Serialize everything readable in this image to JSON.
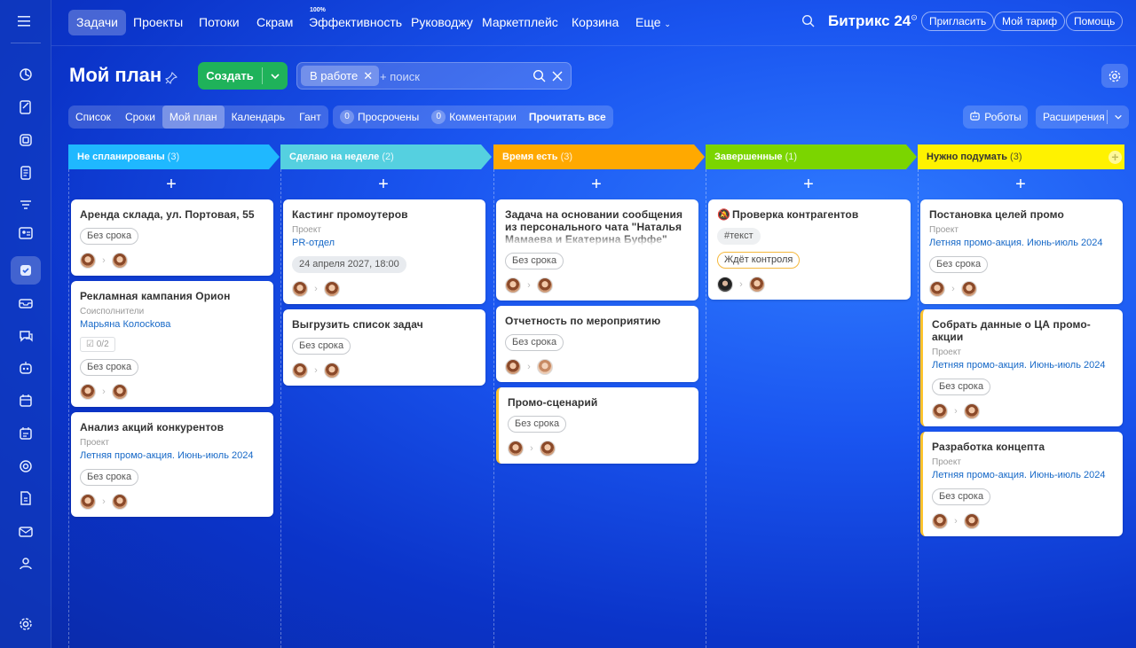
{
  "nav": {
    "items": [
      "Задачи",
      "Проекты",
      "Потоки",
      "Скрам",
      "Эффективность",
      "Руководжу",
      "Маркетплейс",
      "Корзина",
      "Еще"
    ],
    "efficiency_badge": "100%",
    "brand": "Битрикс",
    "brand_num": "24",
    "invite": "Пригласить",
    "tariff": "Мой тариф",
    "help": "Помощь"
  },
  "header": {
    "title": "Мой план",
    "create": "Создать",
    "filter_chip": "В работе",
    "search_placeholder": "+ поиск"
  },
  "tabs": [
    "Список",
    "Сроки",
    "Мой план",
    "Календарь",
    "Гант"
  ],
  "counters": {
    "overdue_num": "0",
    "overdue": "Просрочены",
    "comments_num": "0",
    "comments": "Комментарии",
    "read_all": "Прочитать все"
  },
  "robots": "Роботы",
  "extensions": "Расширения",
  "columns": [
    {
      "title": "Не спланированы",
      "count": "(3)",
      "color": "#1fb8ff",
      "cards": [
        {
          "title": "Аренда склада, ул. Портовая, 55",
          "tag": "Без срока"
        },
        {
          "title": "Рекламная кампания Орион",
          "meta": "Соисполнители",
          "link": "Марьяна Колосkова",
          "checklist": "0/2",
          "tag": "Без срока"
        },
        {
          "title": "Анализ акций конкурентов",
          "meta": "Проект",
          "link": "Летняя промо-акция. Июнь-июль 2024",
          "tag": "Без срока"
        }
      ]
    },
    {
      "title": "Сделаю на неделе",
      "count": "(2)",
      "color": "#55d0e0",
      "cards": [
        {
          "title": "Кастинг промоутеров",
          "meta": "Проект",
          "link": "PR-отдел",
          "tag": "24 апреля 2027, 18:00"
        },
        {
          "title": "Выгрузить список задач",
          "tag": "Без срока"
        }
      ]
    },
    {
      "title": "Время есть",
      "count": "(3)",
      "color": "#ffa900",
      "cards": [
        {
          "title": "Задача на основании сообщения из персонального чата \"Наталья Мамаева и Екатерина Буффе\"",
          "tag": "Без срока"
        },
        {
          "title": "Отчетность по мероприятию",
          "tag": "Без срока"
        },
        {
          "title": "Промо-сценарий",
          "tag": "Без срока"
        }
      ]
    },
    {
      "title": "Завершенные",
      "count": "(1)",
      "color": "#7bd500",
      "cards": [
        {
          "title": "Проверка контрагентов",
          "hashtag": "#текст",
          "control": "Ждёт контроля"
        }
      ]
    },
    {
      "title": "Нужно подумать",
      "count": "(3)",
      "color": "#fff200",
      "cards": [
        {
          "title": "Постановка целей промо",
          "meta": "Проект",
          "link": "Летняя промо-акция. Июнь-июль 2024",
          "tag": "Без срока"
        },
        {
          "title": "Собрать данные о ЦА промо-акции",
          "meta": "Проект",
          "link": "Летняя промо-акция. Июнь-июль 2024",
          "tag": "Без срока"
        },
        {
          "title": "Разработка концепта",
          "meta": "Проект",
          "link": "Летняя промо-акция. Июнь-июль 2024",
          "tag": "Без срока"
        }
      ]
    }
  ],
  "add_symbol": "+"
}
